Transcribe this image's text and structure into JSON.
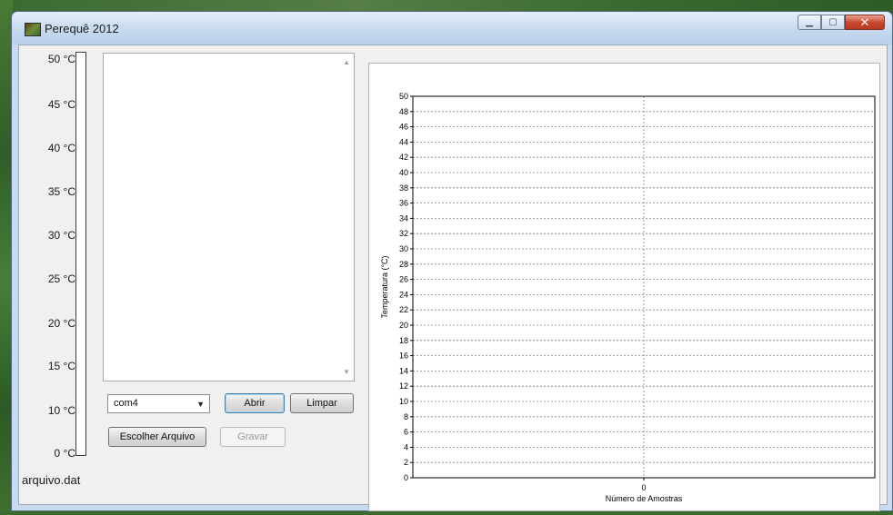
{
  "window": {
    "title": "Perequê 2012",
    "minimize_glyph": "▁",
    "maximize_glyph": "▢",
    "close_glyph": "✕"
  },
  "thermometer": {
    "labels": [
      "50 °C",
      "45 °C",
      "40 °C",
      "35 °C",
      "30 °C",
      "25 °C",
      "20 °C",
      "15 °C",
      "10 °C",
      "0 °C"
    ],
    "level": 0
  },
  "file_label": "arquivo.dat",
  "port_select": {
    "value": "com4"
  },
  "buttons": {
    "abrir": "Abrir",
    "limpar": "Limpar",
    "escolher_arquivo": "Escolher Arquivo",
    "gravar": "Gravar"
  },
  "chart_data": {
    "type": "line",
    "x": [],
    "series": [],
    "xlabel": "Número de Amostras",
    "ylabel": "Temperatura (°C)",
    "xticks": [
      "0"
    ],
    "ylim": [
      0,
      50
    ],
    "yticks": [
      0,
      2,
      4,
      6,
      8,
      10,
      12,
      14,
      16,
      18,
      20,
      22,
      24,
      26,
      28,
      30,
      32,
      34,
      36,
      38,
      40,
      42,
      44,
      46,
      48,
      50
    ],
    "grid": true
  },
  "colors": {
    "close_button": "#c7442a",
    "titlebar": "#c4d8ee",
    "grid": "#808080"
  }
}
